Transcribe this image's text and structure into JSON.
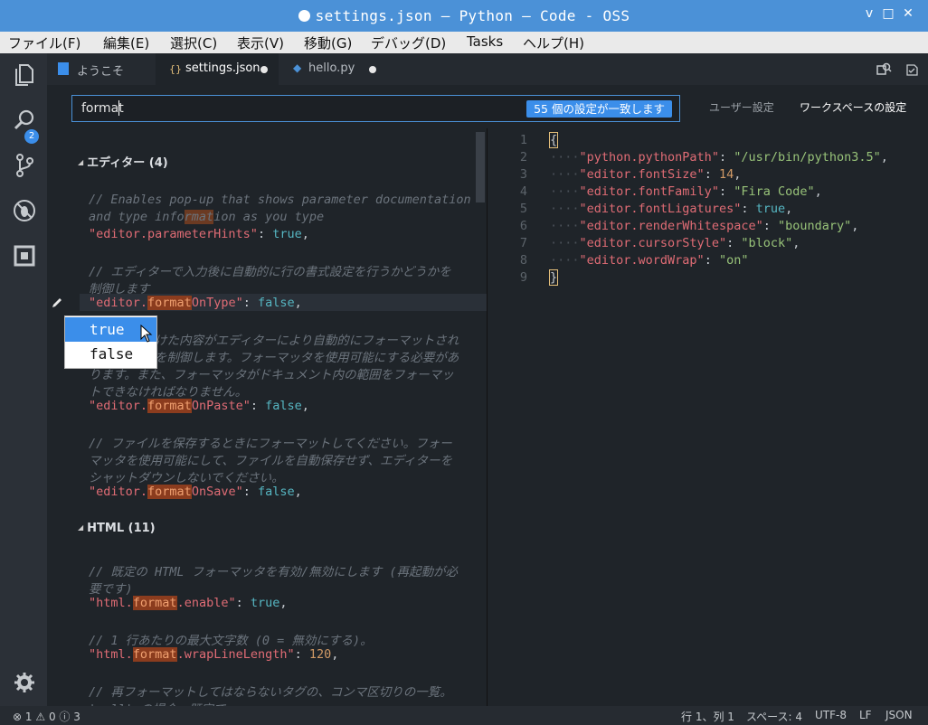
{
  "window": {
    "title": "settings.json — Python — Code - OSS",
    "minimize": "v",
    "maximize": "□",
    "close": "✕"
  },
  "menu": [
    "ファイル(F)",
    "編集(E)",
    "選択(C)",
    "表示(V)",
    "移動(G)",
    "デバッグ(D)",
    "Tasks",
    "ヘルプ(H)"
  ],
  "activity": {
    "explorer_badge": "2"
  },
  "tabs": [
    {
      "label": "ようこそ",
      "icon": "welcome-icon"
    },
    {
      "label": "settings.json",
      "icon": "json-braces-icon",
      "prefix": "{}",
      "dirty": true,
      "active": true
    },
    {
      "label": "hello.py",
      "icon": "python-icon",
      "dirty": true
    }
  ],
  "search": {
    "value": "format",
    "match_count": "55 個の設定が一致します"
  },
  "scopes": {
    "user": "ユーザー設定",
    "workspace": "ワークスペースの設定"
  },
  "defaults": {
    "group1": "エディター (4)",
    "c1a": "// Enables pop-up that shows parameter documentation",
    "c1b_pre": "and type info",
    "c1b_hl": "rmat",
    "c1b_post": "ion as you type",
    "s1": {
      "key": "\"editor.parameterHints\"",
      "value": "true"
    },
    "c2a": "// エディターで入力後に自動的に行の書式設定を行うかどうかを",
    "c2b": "制御します",
    "s2": {
      "pre": "\"editor.",
      "hl": "format",
      "post": "OnType\"",
      "value": "false"
    },
    "c3a": "けた内容がエディターにより自動的にフォーマットされ",
    "c3b": "を制御します。フォーマッタを使用可能にする必要があ",
    "c3c": "ります。また、フォーマッタがドキュメント内の範囲をフォーマッ",
    "c3d": "トできなければなりません。",
    "s3": {
      "pre": "\"editor.",
      "hl": "format",
      "post": "OnPaste\"",
      "value": "false"
    },
    "c4a": "// ファイルを保存するときにフォーマットしてください。フォー",
    "c4b": "マッタを使用可能にして、ファイルを自動保存せず、エディターを",
    "c4c": "シャットダウンしないでください。",
    "s4": {
      "pre": "\"editor.",
      "hl": "format",
      "post": "OnSave\"",
      "value": "false"
    },
    "group2": "HTML (11)",
    "c5a": "// 既定の HTML フォーマッタを有効/無効にします (再起動が必",
    "c5b": "要です)",
    "s5": {
      "pre": "\"html.",
      "hl": "format",
      "post": ".enable\"",
      "value": "true"
    },
    "c6a": "// 1 行あたりの最大文字数 (0 = 無効にする)。",
    "s6": {
      "pre": "\"html.",
      "hl": "format",
      "post": ".wrapLineLength\"",
      "value": "120"
    },
    "c7a": "// 再フォーマットしてはならないタグの、コンマ区切りの一覧。",
    "c7b": "'null' の場合、既定で"
  },
  "dropdown": {
    "options": [
      "true",
      "false"
    ],
    "selected": "true"
  },
  "workspace_json": {
    "open": "{",
    "close": "}",
    "lines": [
      {
        "key": "\"python.pythonPath\"",
        "value": "\"/usr/bin/python3.5\""
      },
      {
        "key": "\"editor.fontSize\"",
        "value": "14"
      },
      {
        "key": "\"editor.fontFamily\"",
        "value": "\"Fira Code\""
      },
      {
        "key": "\"editor.fontLigatures\"",
        "value": "true"
      },
      {
        "key": "\"editor.renderWhitespace\"",
        "value": "\"boundary\""
      },
      {
        "key": "\"editor.cursorStyle\"",
        "value": "\"block\""
      },
      {
        "key": "\"editor.wordWrap\"",
        "value": "\"on\""
      }
    ],
    "line_numbers": [
      "1",
      "2",
      "3",
      "4",
      "5",
      "6",
      "7",
      "8",
      "9"
    ]
  },
  "status": {
    "errors": "1",
    "warnings": "0",
    "info": "3",
    "position": "行 1、列 1",
    "spaces": "スペース: 4",
    "encoding": "UTF-8",
    "eol": "LF",
    "language": "JSON"
  }
}
